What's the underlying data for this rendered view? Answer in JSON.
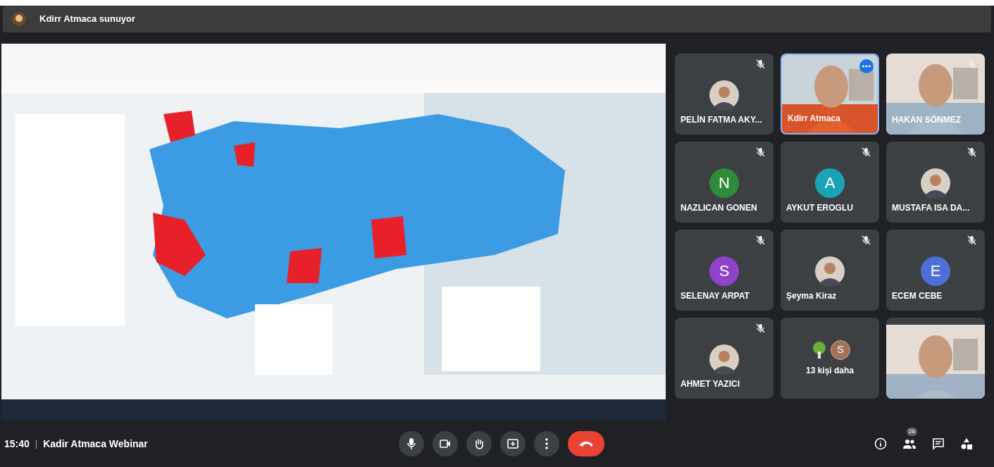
{
  "presenter_bar": {
    "text": "Kdirr Atmaca sunuyor"
  },
  "participants": [
    {
      "name": "PELİN FATMA AKY...",
      "muted": true,
      "speaking": false
    },
    {
      "name": "Kdirr Atmaca",
      "kind": "video",
      "muted": false,
      "speaking": true
    },
    {
      "name": "HAKAN SÖNMEZ",
      "kind": "video",
      "muted": true,
      "speaking": false
    },
    {
      "name": "NAZLICAN GONEN",
      "kind": "letter",
      "letter": "N",
      "color": "#2e8b3a",
      "muted": true,
      "speaking": false
    },
    {
      "name": "AYKUT EROGLU",
      "kind": "letter",
      "letter": "A",
      "color": "#1aa3b5",
      "muted": true,
      "speaking": false
    },
    {
      "name": "MUSTAFA ISA DA...",
      "muted": true,
      "speaking": false
    },
    {
      "name": "SELENAY ARPAT",
      "kind": "letter",
      "letter": "S",
      "color": "#8e44c9",
      "muted": true,
      "speaking": false
    },
    {
      "name": "Şeyma Kiraz",
      "muted": true,
      "speaking": false
    },
    {
      "name": "ECEM CEBE",
      "kind": "letter",
      "letter": "E",
      "color": "#4f6fd8",
      "muted": true,
      "speaking": false
    },
    {
      "name": "AHMET YAZICI",
      "muted": true,
      "speaking": false
    },
    {
      "name": "13 kişi daha",
      "kind": "more",
      "letter": "S",
      "color": "#a0725a",
      "muted": false,
      "speaking": false
    },
    {
      "kind": "video",
      "muted": false,
      "speaking": false
    }
  ],
  "bottom_bar": {
    "time": "15:40",
    "separator": "|",
    "meeting_name": "Kadir Atmaca Webinar",
    "participant_count": "26"
  }
}
